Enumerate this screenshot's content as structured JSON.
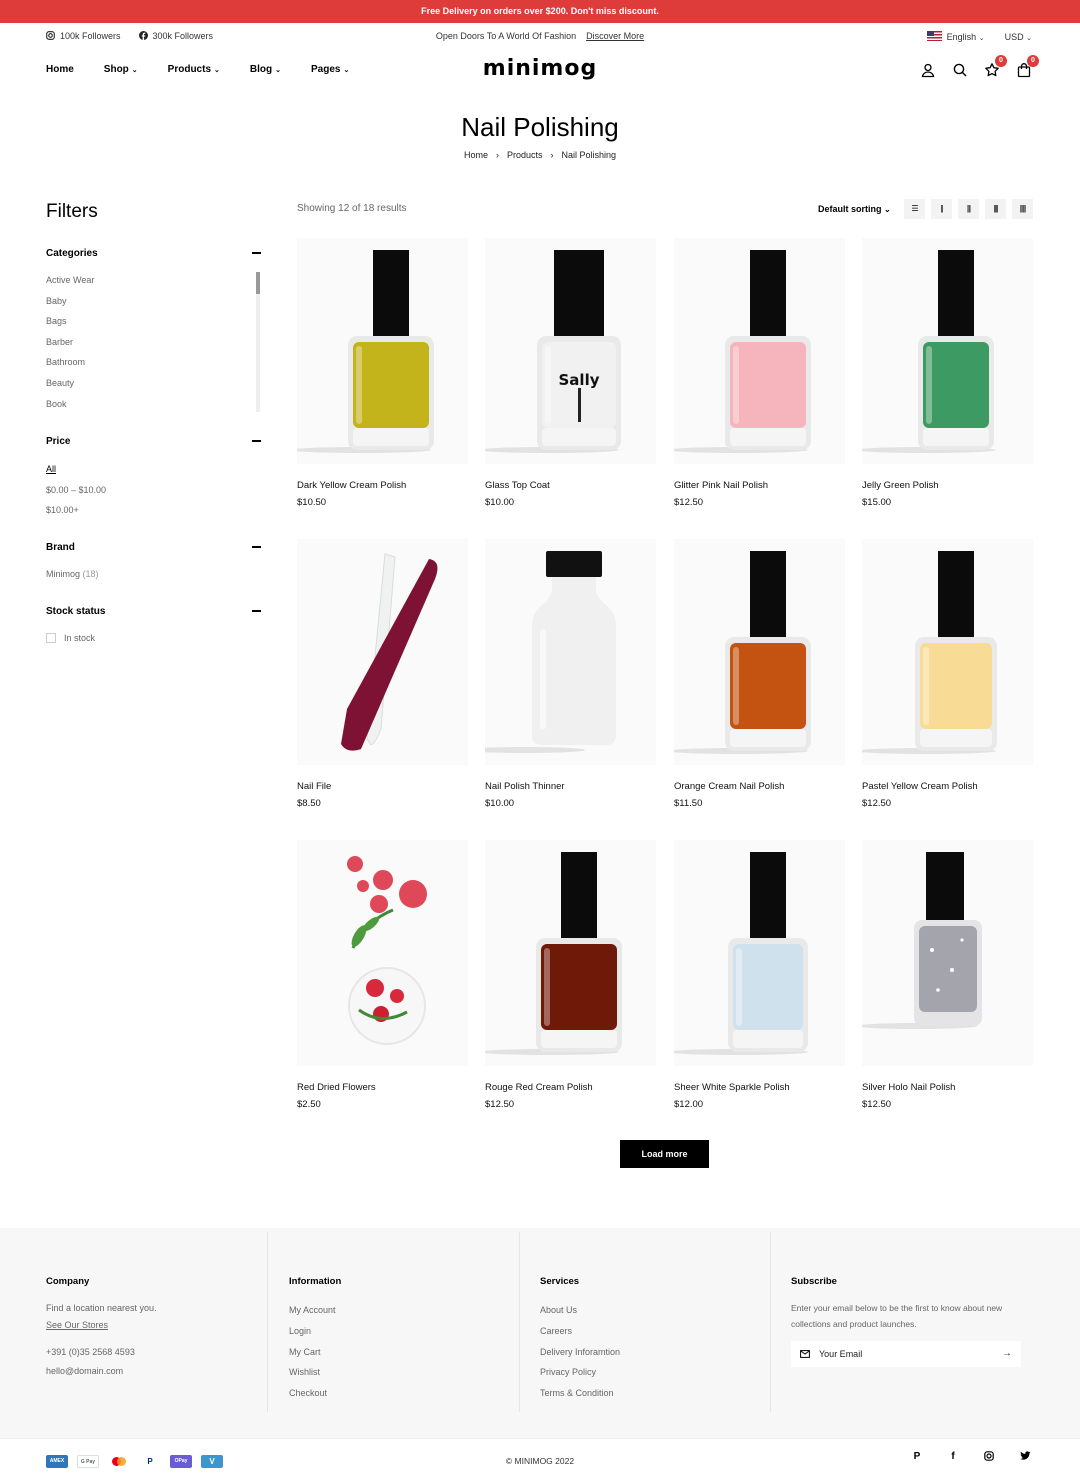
{
  "promo": "Free Delivery on orders over $200. Don't miss discount.",
  "subbar": {
    "instagram": "100k Followers",
    "facebook": "300k Followers",
    "tagline": "Open Doors To A World Of Fashion",
    "discover": "Discover More",
    "language": "English",
    "currency": "USD"
  },
  "nav": {
    "items": [
      {
        "label": "Home"
      },
      {
        "label": "Shop"
      },
      {
        "label": "Products"
      },
      {
        "label": "Blog"
      },
      {
        "label": "Pages"
      }
    ],
    "logo": "minimog",
    "wishlist_count": "0",
    "cart_count": "0"
  },
  "page": {
    "title": "Nail Polishing",
    "breadcrumb": [
      "Home",
      "Products",
      "Nail Polishing"
    ]
  },
  "filters": {
    "title": "Filters",
    "categories_title": "Categories",
    "categories": [
      "Active Wear",
      "Baby",
      "Bags",
      "Barber",
      "Bathroom",
      "Beauty",
      "Book"
    ],
    "price_title": "Price",
    "prices": [
      "All",
      "$0.00 – $10.00",
      "$10.00+"
    ],
    "brand_title": "Brand",
    "brand": "Minimog",
    "brand_count": "(18)",
    "stock_title": "Stock status",
    "stock_option": "In stock"
  },
  "toolbar": {
    "showing": "Showing 12 of 18 results",
    "sorting": "Default sorting"
  },
  "products": [
    {
      "name": "Dark Yellow Cream Polish",
      "price": "$10.50",
      "color": "#c2b41a"
    },
    {
      "name": "Glass Top Coat",
      "price": "$10.00",
      "color": "#efefef",
      "label": "Sally"
    },
    {
      "name": "Glitter Pink Nail Polish",
      "price": "$12.50",
      "color": "#f6b4bc"
    },
    {
      "name": "Jelly Green Polish",
      "price": "$15.00",
      "color": "#3d9a62"
    },
    {
      "name": "Nail File",
      "price": "$8.50",
      "color": "#7d1235"
    },
    {
      "name": "Nail Polish Thinner",
      "price": "$10.00",
      "color": "#f0f0f0"
    },
    {
      "name": "Orange Cream Nail Polish",
      "price": "$11.50",
      "color": "#c45210"
    },
    {
      "name": "Pastel Yellow Cream Polish",
      "price": "$12.50",
      "color": "#f8dc95"
    },
    {
      "name": "Red Dried Flowers",
      "price": "$2.50",
      "color": "#d8283c"
    },
    {
      "name": "Rouge Red Cream Polish",
      "price": "$12.50",
      "color": "#6f1a08"
    },
    {
      "name": "Sheer White Sparkle Polish",
      "price": "$12.00",
      "color": "#cfe1ec"
    },
    {
      "name": "Silver Holo Nail Polish",
      "price": "$12.50",
      "color": "#a4a4ac"
    }
  ],
  "load_more": "Load more",
  "footer": {
    "company_title": "Company",
    "company_text": "Find a location nearest you.",
    "stores_link": "See Our Stores",
    "phone": "+391 (0)35 2568 4593",
    "email": "hello@domain.com",
    "info_title": "Information",
    "info_links": [
      "My Account",
      "Login",
      "My Cart",
      "Wishlist",
      "Checkout"
    ],
    "services_title": "Services",
    "services_links": [
      "About Us",
      "Careers",
      "Delivery Inforamtion",
      "Privacy Policy",
      "Terms & Condition"
    ],
    "subscribe_title": "Subscribe",
    "subscribe_text_1": "Enter your email below to be the first to know about new",
    "subscribe_text_2": "collections and product launches.",
    "email_placeholder": "Your Email",
    "copyright": "© MINIMOG 2022"
  },
  "icons": {
    "payments": [
      "amex-icon",
      "gpay-icon",
      "mastercard-icon",
      "paypal-icon",
      "opay-icon",
      "venmo-icon"
    ],
    "social": [
      "pinterest-icon",
      "facebook-icon",
      "instagram-icon",
      "twitter-icon"
    ]
  }
}
